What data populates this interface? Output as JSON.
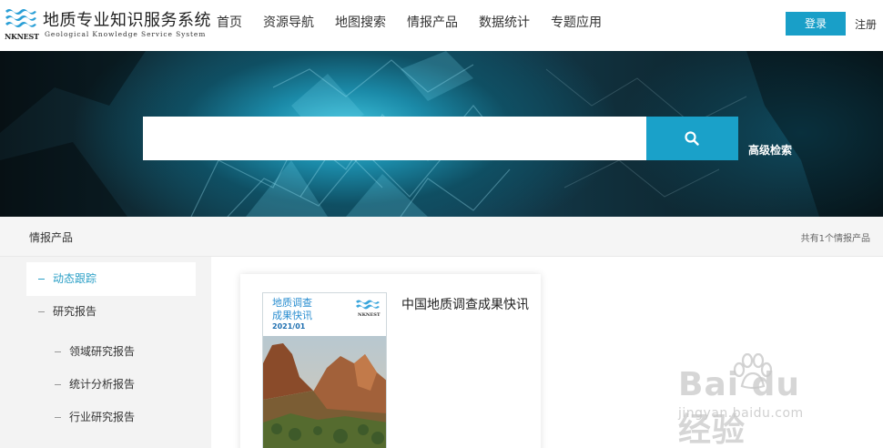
{
  "header": {
    "brand_abbr": "NKNEST",
    "title": "地质专业知识服务系统",
    "subtitle": "Geological Knowledge Service System",
    "nav": [
      {
        "label": "首页"
      },
      {
        "label": "资源导航"
      },
      {
        "label": "地图搜索"
      },
      {
        "label": "情报产品"
      },
      {
        "label": "数据统计"
      },
      {
        "label": "专题应用"
      }
    ],
    "login_label": "登录",
    "register_label": "注册"
  },
  "search": {
    "value": "",
    "placeholder": "",
    "button_icon": "search-icon",
    "advanced_label": "高级检索"
  },
  "breadcrumb": {
    "title": "情报产品",
    "count_text": "共有1个情报产品"
  },
  "sidebar": {
    "items": [
      {
        "label": "动态跟踪",
        "active": true
      },
      {
        "label": "研究报告",
        "active": false
      }
    ],
    "sub_items": [
      {
        "label": "领域研究报告"
      },
      {
        "label": "统计分析报告"
      },
      {
        "label": "行业研究报告"
      }
    ]
  },
  "products": [
    {
      "title": "中国地质调查成果快讯",
      "cover_title_line1": "地质调查",
      "cover_title_line2": "成果快讯",
      "cover_date": "2021/01",
      "cover_brand": "NKNEST"
    }
  ],
  "watermark": {
    "main": "Bai du 经验",
    "sub": "jingyan.baidu.com"
  },
  "colors": {
    "accent": "#1aa1c9",
    "active_text": "#2a9fc6",
    "sidebar_bg": "#f3f3f3",
    "bar_bg": "#f5f5f5"
  }
}
